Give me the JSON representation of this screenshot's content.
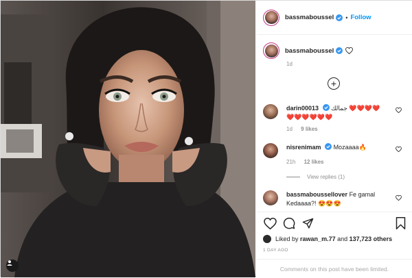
{
  "post": {
    "username": "bassmaboussel",
    "follow_label": "Follow",
    "separator": "•",
    "caption_time": "1d",
    "comments": [
      {
        "user": "darin00013",
        "verified": true,
        "text": "جمالك ❤️❤️❤️❤️",
        "text2": "❤️❤️❤️❤️❤️❤️",
        "time": "1d",
        "likes": "9 likes"
      },
      {
        "user": "nisrenimam",
        "verified": true,
        "text": "Mozaaaa🔥",
        "time": "21h",
        "likes": "12 likes",
        "replies": "View replies (1)"
      },
      {
        "user": "bassmaboussellover",
        "verified": false,
        "text": "Fe gamal",
        "text2": "Kedaaaa?! 😍😍😍"
      }
    ],
    "liked_by_prefix": "Liked by",
    "liked_by_user": "rawan_m.77",
    "liked_by_and": "and",
    "liked_by_others": "137,723 others",
    "post_age": "1 DAY AGO",
    "comments_limited": "Comments on this post have been limited."
  },
  "colors": {
    "link_blue": "#0095f6",
    "verified_blue": "#3897f0",
    "heart_red": "#ed4956",
    "meta_gray": "#8e8e8e"
  },
  "icons": [
    "verified-icon",
    "heart-icon",
    "comment-icon",
    "share-icon",
    "bookmark-icon",
    "plus-circle-icon",
    "tag-person-icon"
  ]
}
